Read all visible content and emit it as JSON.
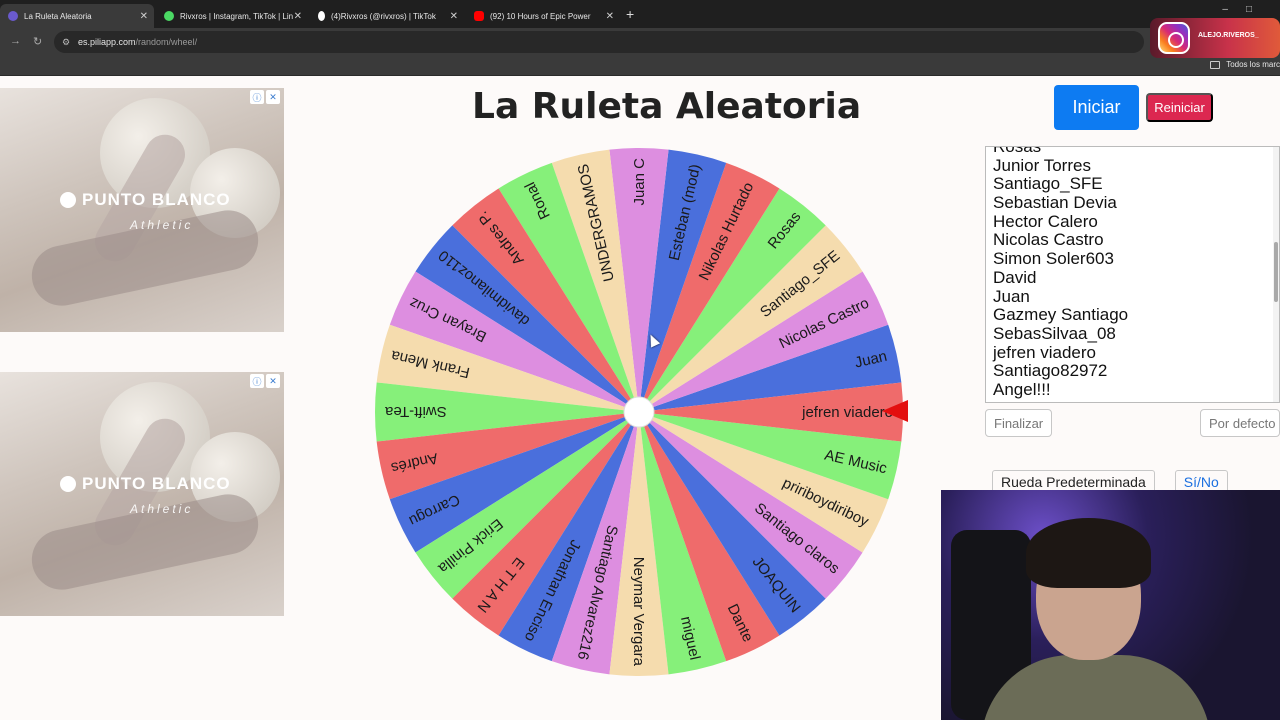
{
  "browser": {
    "tabs": [
      {
        "title": "La Ruleta Aleatoria",
        "active": true,
        "favicon_color": "#6a5acd"
      },
      {
        "title": "Rivxros | Instagram, TikTok | Lin",
        "active": false,
        "favicon_color": "#4bd964"
      },
      {
        "title": "(4)Rivxros (@rivxros) | TikTok",
        "active": false,
        "favicon_color": "#ffffff"
      },
      {
        "title": "(92) 10 Hours of Epic Power",
        "active": false,
        "favicon_color": "#ff0000"
      }
    ],
    "url_host": "es.piliapp.com",
    "url_path": "/random/wheel/",
    "bookmarks_folder": "Todos los marc"
  },
  "overlay": {
    "instagram_handle": "ALEJO.RIVEROS_"
  },
  "ads": [
    {
      "brand": "PUNTO BLANCO",
      "sub": "Athletic"
    },
    {
      "brand": "PUNTO BLANCO",
      "sub": "Athletic"
    }
  ],
  "page": {
    "title": "La Ruleta Aleatoria",
    "start_button": "Iniciar",
    "reset_button": "Reiniciar",
    "finish_button": "Finalizar",
    "default_button": "Por defecto",
    "preset_label": "Rueda Predeterminada",
    "yes_no_label": "Sí/No"
  },
  "names_list": [
    "Rosas",
    "Junior Torres",
    "Santiago_SFE",
    "Sebastian Devia",
    "Hector Calero",
    "Nicolas Castro",
    "Simon Soler603",
    "David",
    "Juan",
    "Gazmey Santiago",
    "SebasSilvaa_08",
    "jefren viadero",
    "Santiago82972",
    "Angel!!!"
  ],
  "wheel": {
    "segments": [
      {
        "label": "Juan",
        "color": "#4a6fdc"
      },
      {
        "label": "Nicolas Castro",
        "color": "#dd8ee0"
      },
      {
        "label": "Santiago_SFE",
        "color": "#f5dcae"
      },
      {
        "label": "Rosas",
        "color": "#86f07a"
      },
      {
        "label": "Nikolas Hurtado",
        "color": "#ef6b6b"
      },
      {
        "label": "Esteban (mod)",
        "color": "#4a6fdc"
      },
      {
        "label": "Juan C",
        "color": "#dd8ee0"
      },
      {
        "label": "UNDERGRAMOS",
        "color": "#f5dcae"
      },
      {
        "label": "Ronal",
        "color": "#86f07a"
      },
      {
        "label": "Andres P.",
        "color": "#ef6b6b"
      },
      {
        "label": "davidmilanoz110",
        "color": "#4a6fdc"
      },
      {
        "label": "Brayan Cruz",
        "color": "#dd8ee0"
      },
      {
        "label": "Frank Mena",
        "color": "#f5dcae"
      },
      {
        "label": "Swift-Tea",
        "color": "#86f07a"
      },
      {
        "label": "Andrés",
        "color": "#ef6b6b"
      },
      {
        "label": "Carrogu",
        "color": "#4a6fdc"
      },
      {
        "label": "Erick Pinilla",
        "color": "#86f07a"
      },
      {
        "label": "E T H A N",
        "color": "#ef6b6b"
      },
      {
        "label": "Jonathan Enciso",
        "color": "#4a6fdc"
      },
      {
        "label": "Santiago Alvarez216",
        "color": "#dd8ee0"
      },
      {
        "label": "Neymar Vergara",
        "color": "#f5dcae"
      },
      {
        "label": "miguel",
        "color": "#86f07a"
      },
      {
        "label": "Dante",
        "color": "#ef6b6b"
      },
      {
        "label": "JOAQUIN",
        "color": "#4a6fdc"
      },
      {
        "label": "Santiago claros",
        "color": "#dd8ee0"
      },
      {
        "label": "pririboydiriboy",
        "color": "#f5dcae"
      },
      {
        "label": "AE Music",
        "color": "#86f07a"
      },
      {
        "label": "jefren viadero",
        "color": "#ef6b6b"
      }
    ]
  }
}
